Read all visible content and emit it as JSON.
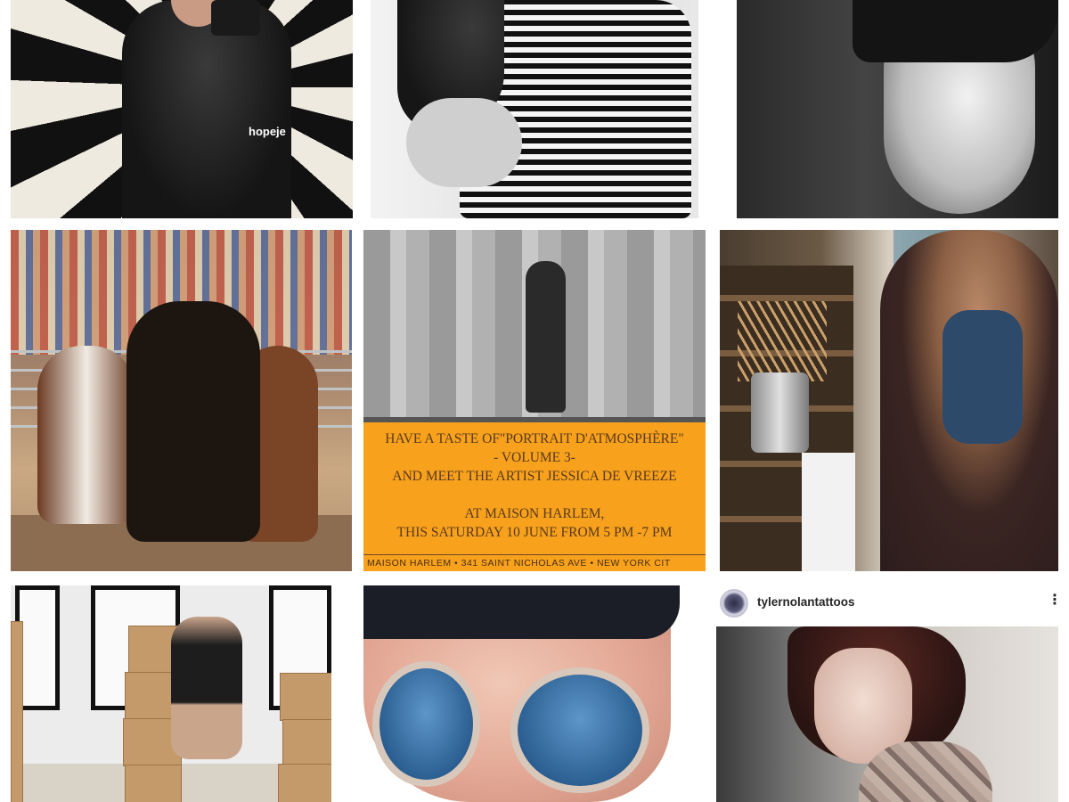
{
  "grid": {
    "tiles": [
      {
        "overlay_username": "hopeje"
      },
      {},
      {},
      {},
      {
        "poster": {
          "lines": [
            "HAVE A TASTE OF\"PORTRAIT D'ATMOSPHÈRE\"",
            "- VOLUME 3-",
            "AND MEET THE ARTIST JESSICA DE VREEZE",
            "AT MAISON HARLEM,",
            "THIS SATURDAY 10 JUNE FROM 5 PM -7 PM"
          ],
          "footer": "MAISON HARLEM  •  341 SAINT NICHOLAS AVE  •  NEW YORK CIT",
          "colors": {
            "background": "#f7a11d",
            "text": "#5a3a1c"
          }
        }
      },
      {},
      {},
      {},
      {
        "post_header": {
          "username": "tylernolantattoos",
          "more_icon": "more-options-icon",
          "more_glyph": "⋮"
        }
      }
    ]
  }
}
